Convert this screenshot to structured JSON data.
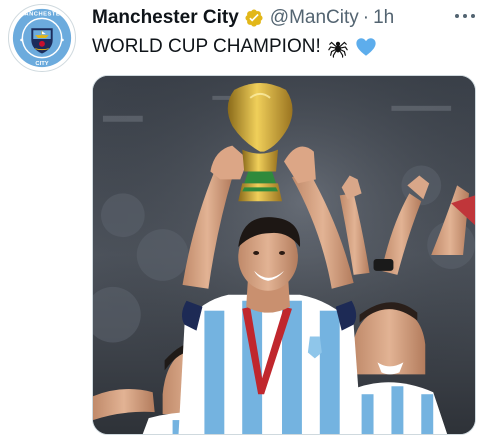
{
  "tweet": {
    "display_name": "Manchester City",
    "handle": "@ManCity",
    "separator": "·",
    "time": "1h",
    "text": "WORLD CUP CHAMPION!",
    "emojis": [
      "spider-emoji",
      "blue-heart-emoji"
    ]
  },
  "avatar": {
    "badge_top_text": "MANCHESTER",
    "badge_bottom_text": "CITY"
  },
  "icons": {
    "verified": "verified-badge-icon",
    "more": "more-options-icon"
  },
  "colors": {
    "verified_gold": "#e2b719",
    "city_blue": "#6cabdd",
    "city_navy": "#1c2c5b",
    "heart_blue": "#5dadec",
    "secondary_text": "#536471"
  },
  "media": {
    "description_alt": "Photo"
  }
}
